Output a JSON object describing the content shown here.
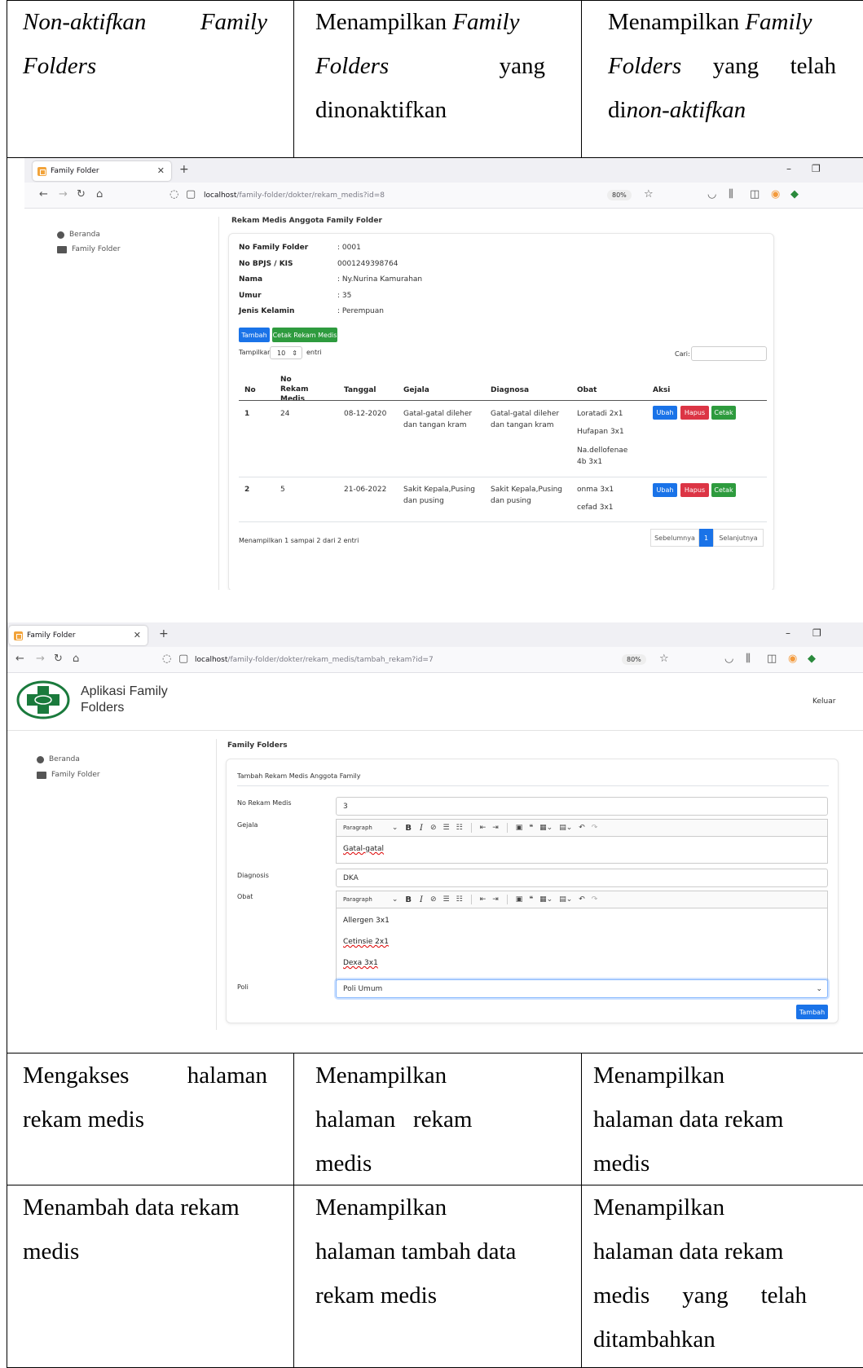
{
  "table": {
    "row1": {
      "c1_a": "Non-aktifkan",
      "c1_b": "Family",
      "c1_c": "Folders",
      "c2_a": "Menampilkan",
      "c2_b": "Family",
      "c2_c": "Folders",
      "c2_d": "yang",
      "c2_e": "dinonaktifkan",
      "c3_a": "Menampilkan",
      "c3_b": "Family",
      "c3_c": "Folders",
      "c3_d": "yang",
      "c3_e": "telah",
      "c3_f": "di",
      "c3_g": "non-aktifkan"
    },
    "row3": {
      "c1_a": "Mengakses",
      "c1_b": "halaman",
      "c1_c": "rekam medis",
      "c2_a": "Menampilkan",
      "c2_b": "halaman",
      "c2_c": "rekam",
      "c2_d": "medis",
      "c3_a": "Menampilkan",
      "c3_b": "halaman data rekam",
      "c3_c": "medis"
    },
    "row4": {
      "c1_a": "Menambah data rekam",
      "c1_b": "medis",
      "c2_a": "Menampilkan",
      "c2_b": "halaman tambah data",
      "c2_c": "rekam medis",
      "c3_a": "Menampilkan",
      "c3_b": "halaman data rekam",
      "c3_c": "medis",
      "c3_d": "yang",
      "c3_e": "telah",
      "c3_f": "ditambahkan"
    }
  },
  "shot1": {
    "tab_title": "Family Folder",
    "url_host": "localhost",
    "url_path": "/family-folder/dokter/rekam_medis?id=8",
    "zoom": "80%",
    "sidebar": [
      "Beranda",
      "Family Folder"
    ],
    "panel_title": "Rekam Medis Anggota Family Folder",
    "fields": [
      {
        "label": "No Family Folder",
        "value": ": 0001"
      },
      {
        "label": "No BPJS / KIS",
        "value": "0001249398764"
      },
      {
        "label": "Nama",
        "value": ": Ny.Nurina Kamurahan"
      },
      {
        "label": "Umur",
        "value": ": 35"
      },
      {
        "label": "Jenis Kelamin",
        "value": ": Perempuan"
      }
    ],
    "btn_tambah": "Tambah",
    "btn_cetak": "Cetak Rekam Medis",
    "show_label": "Tampilkan",
    "show_value": "10",
    "show_suffix": "entri",
    "search_label": "Cari:",
    "headers": [
      "No",
      "No Rekam Medis",
      "Tanggal",
      "Gejala",
      "Diagnosa",
      "Obat",
      "Aksi"
    ],
    "rows": [
      {
        "no": "1",
        "rm": "24",
        "tanggal": "08-12-2020",
        "gejala": "Gatal-gatal dileher dan tangan kram",
        "diagnosa": "Gatal-gatal dileher dan tangan kram",
        "obat": [
          "Loratadi 2x1",
          "Hufapan 3x1",
          "Na.dellofenae 4b 3x1"
        ]
      },
      {
        "no": "2",
        "rm": "5",
        "tanggal": "21-06-2022",
        "gejala": "Sakit Kepala,Pusing dan pusing",
        "diagnosa": "Sakit Kepala,Pusing dan pusing",
        "obat": [
          "onma  3x1",
          "cefad 3x1"
        ]
      }
    ],
    "action_ubah": "Ubah",
    "action_hapus": "Hapus",
    "action_cetak": "Cetak",
    "footer_info": "Menampilkan 1 sampai 2 dari 2 entri",
    "pager_prev": "Sebelumnya",
    "pager_page": "1",
    "pager_next": "Selanjutnya"
  },
  "shot2": {
    "tab_title": "Family Folder",
    "url_host": "localhost",
    "url_path": "/family-folder/dokter/rekam_medis/tambah_rekam?id=7",
    "zoom": "80%",
    "app_name_1": "Aplikasi Family",
    "app_name_2": "Folders",
    "logout": "Keluar",
    "sidebar": [
      "Beranda",
      "Family Folder"
    ],
    "panel_title": "Family Folders",
    "card_title": "Tambah Rekam Medis Anggota Family",
    "labels": {
      "rm": "No Rekam Medis",
      "gejala": "Gejala",
      "diagnosis": "Diagnosis",
      "obat": "Obat",
      "poli": "Poli"
    },
    "rm_value": "3",
    "paragraph": "Paragraph",
    "gejala_value": "Gatal-gatal",
    "diagnosis_value": "DKA",
    "obat_lines": [
      "Allergen 3x1",
      "Cetinsie 2x1",
      "Dexa 3x1"
    ],
    "poli_value": "Poli Umum",
    "submit": "Tambah"
  }
}
